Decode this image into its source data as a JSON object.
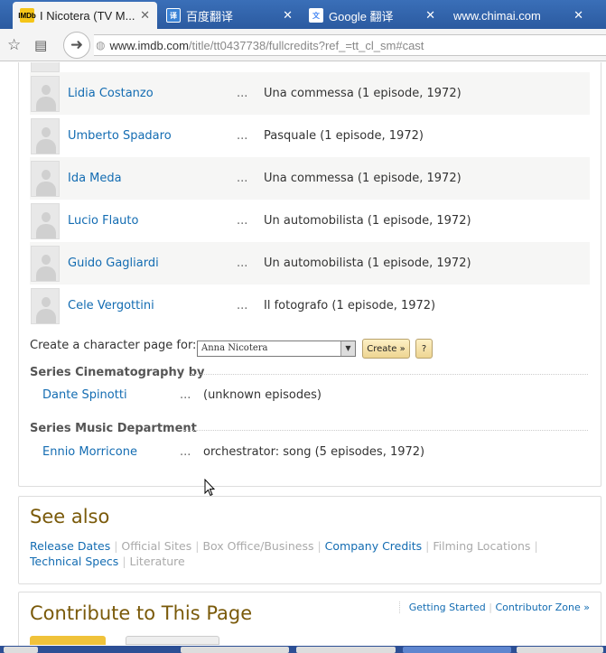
{
  "browser": {
    "tabs": [
      {
        "title": "I Nicotera (TV M...",
        "favicon": "IMDb",
        "active": true
      },
      {
        "title": "百度翻译",
        "favicon": "baidu-translate-icon",
        "active": false
      },
      {
        "title": "Google 翻译",
        "favicon": "google-translate-icon",
        "active": false
      },
      {
        "title": "www.chimai.com",
        "favicon": "",
        "active": false
      }
    ],
    "url_host": "www.imdb.com",
    "url_path": "/title/tt0437738/fullcredits?ref_=tt_cl_sm#cast"
  },
  "cast": [
    {
      "name": "Lidia Costanzo",
      "role": "Una commessa (1 episode, 1972)"
    },
    {
      "name": "Umberto Spadaro",
      "role": "Pasquale (1 episode, 1972)"
    },
    {
      "name": "Ida Meda",
      "role": "Una commessa (1 episode, 1972)"
    },
    {
      "name": "Lucio Flauto",
      "role": "Un automobilista (1 episode, 1972)"
    },
    {
      "name": "Guido Gagliardi",
      "role": "Un automobilista (1 episode, 1972)"
    },
    {
      "name": "Cele Vergottini",
      "role": "Il fotografo (1 episode, 1972)"
    }
  ],
  "ellipsis": "...",
  "character_page": {
    "label": "Create a character page for:",
    "selected": "Anna Nicotera",
    "create_button": "Create »",
    "help_button": "?"
  },
  "crew_sections": [
    {
      "title": "Series Cinematography by",
      "name": "Dante Spinotti",
      "desc": "(unknown episodes)"
    },
    {
      "title": "Series Music Department",
      "name": "Ennio Morricone",
      "desc": "orchestrator: song (5 episodes, 1972)"
    }
  ],
  "see_also": {
    "title": "See also",
    "links": [
      {
        "label": "Release Dates",
        "enabled": true
      },
      {
        "label": "Official Sites",
        "enabled": false
      },
      {
        "label": "Box Office/Business",
        "enabled": false
      },
      {
        "label": "Company Credits",
        "enabled": true
      },
      {
        "label": "Filming Locations",
        "enabled": false
      },
      {
        "label": "Technical Specs",
        "enabled": true
      },
      {
        "label": "Literature",
        "enabled": false
      }
    ]
  },
  "contribute": {
    "title": "Contribute to This Page",
    "getting_started": "Getting Started",
    "contributor_zone": "Contributor Zone »"
  },
  "colors": {
    "link": "#136cb2",
    "heading": "#7a5a0a",
    "tabbar": "#2b5aa0"
  }
}
